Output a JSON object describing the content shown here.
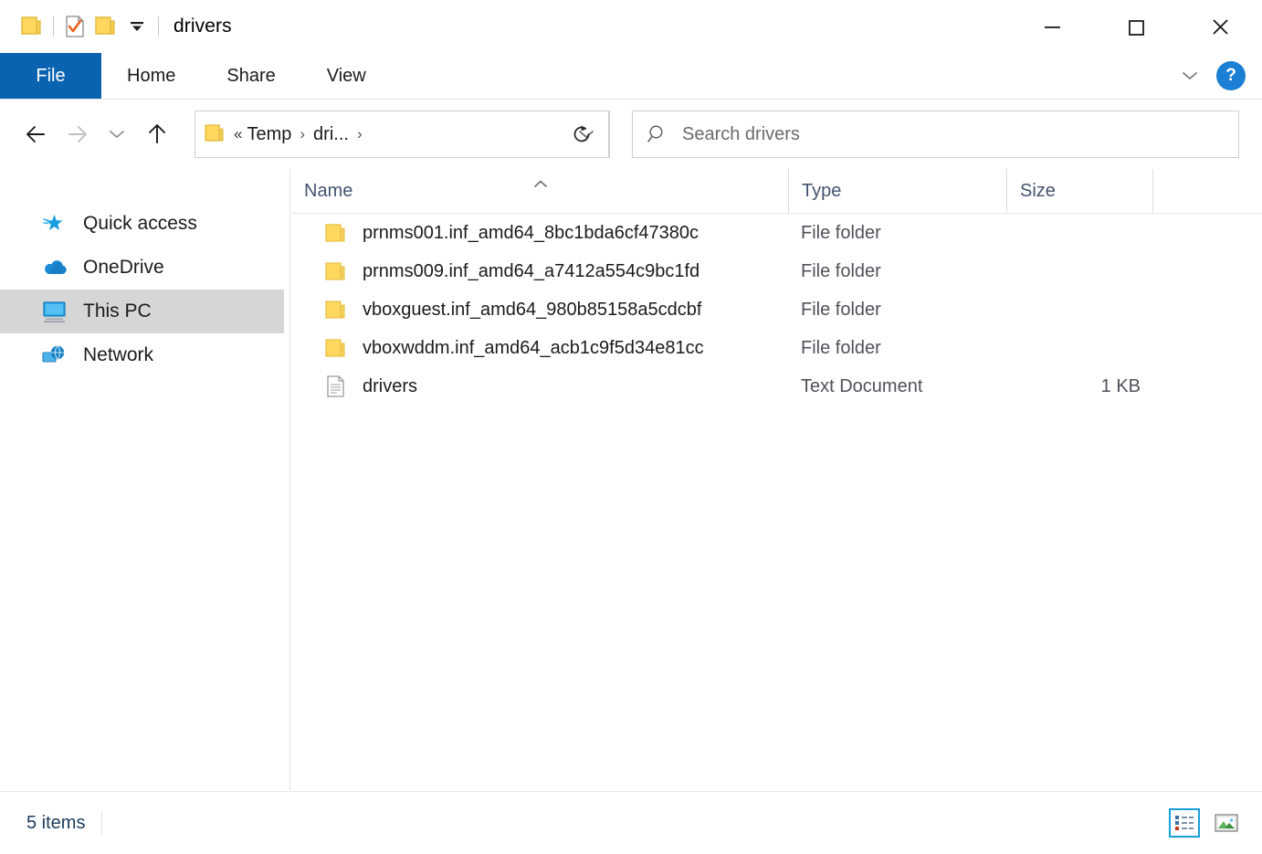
{
  "window": {
    "title": "drivers",
    "quick_access_toolbar": [
      {
        "name": "folder-icon",
        "label": "Folder"
      },
      {
        "name": "properties-icon",
        "label": "Properties"
      },
      {
        "name": "new-folder-icon",
        "label": "New folder"
      },
      {
        "name": "customize-dropdown-icon",
        "label": "Customize Quick Access Toolbar"
      }
    ],
    "controls": {
      "minimize": "Minimize",
      "maximize": "Maximize",
      "close": "Close"
    }
  },
  "ribbon": {
    "tabs": [
      {
        "label": "File",
        "active": true
      },
      {
        "label": "Home",
        "active": false
      },
      {
        "label": "Share",
        "active": false
      },
      {
        "label": "View",
        "active": false
      }
    ],
    "expand_label": "Expand the Ribbon",
    "help_label": "?"
  },
  "navigation": {
    "back_label": "Back",
    "forward_label": "Forward",
    "recent_label": "Recent locations",
    "up_label": "Up",
    "refresh_label": "Refresh"
  },
  "address": {
    "double_chevron": "«",
    "separator": "›",
    "crumbs": [
      "Temp",
      "dri..."
    ],
    "dropdown_label": "Previous locations"
  },
  "search": {
    "placeholder": "Search drivers"
  },
  "sidebar": {
    "items": [
      {
        "label": "Quick access",
        "icon": "star-icon",
        "selected": false
      },
      {
        "label": "OneDrive",
        "icon": "cloud-icon",
        "selected": false
      },
      {
        "label": "This PC",
        "icon": "monitor-icon",
        "selected": true
      },
      {
        "label": "Network",
        "icon": "network-icon",
        "selected": false
      }
    ]
  },
  "filelist": {
    "columns": [
      {
        "label": "Name",
        "sorted": "asc"
      },
      {
        "label": "Type",
        "sorted": ""
      },
      {
        "label": "Size",
        "sorted": ""
      }
    ],
    "rows": [
      {
        "name": "prnms001.inf_amd64_8bc1bda6cf47380c",
        "type": "File folder",
        "size": "",
        "icon": "folder-icon"
      },
      {
        "name": "prnms009.inf_amd64_a7412a554c9bc1fd",
        "type": "File folder",
        "size": "",
        "icon": "folder-icon"
      },
      {
        "name": "vboxguest.inf_amd64_980b85158a5cdcbf",
        "type": "File folder",
        "size": "",
        "icon": "folder-icon"
      },
      {
        "name": "vboxwddm.inf_amd64_acb1c9f5d34e81cc",
        "type": "File folder",
        "size": "",
        "icon": "folder-icon"
      },
      {
        "name": "drivers",
        "type": "Text Document",
        "size": "1 KB",
        "icon": "text-document-icon"
      }
    ]
  },
  "statusbar": {
    "item_count": "5 items",
    "views": [
      {
        "name": "details-view-button",
        "label": "Details view",
        "active": true
      },
      {
        "name": "large-icons-view-button",
        "label": "Large icons view",
        "active": false
      }
    ]
  },
  "colors": {
    "accent_blue": "#0a63b0",
    "folder_yellow": "#ffd75e",
    "header_text": "#44546f",
    "selection_grey": "#d6d6d6",
    "view_active_border": "#18a0d8"
  }
}
